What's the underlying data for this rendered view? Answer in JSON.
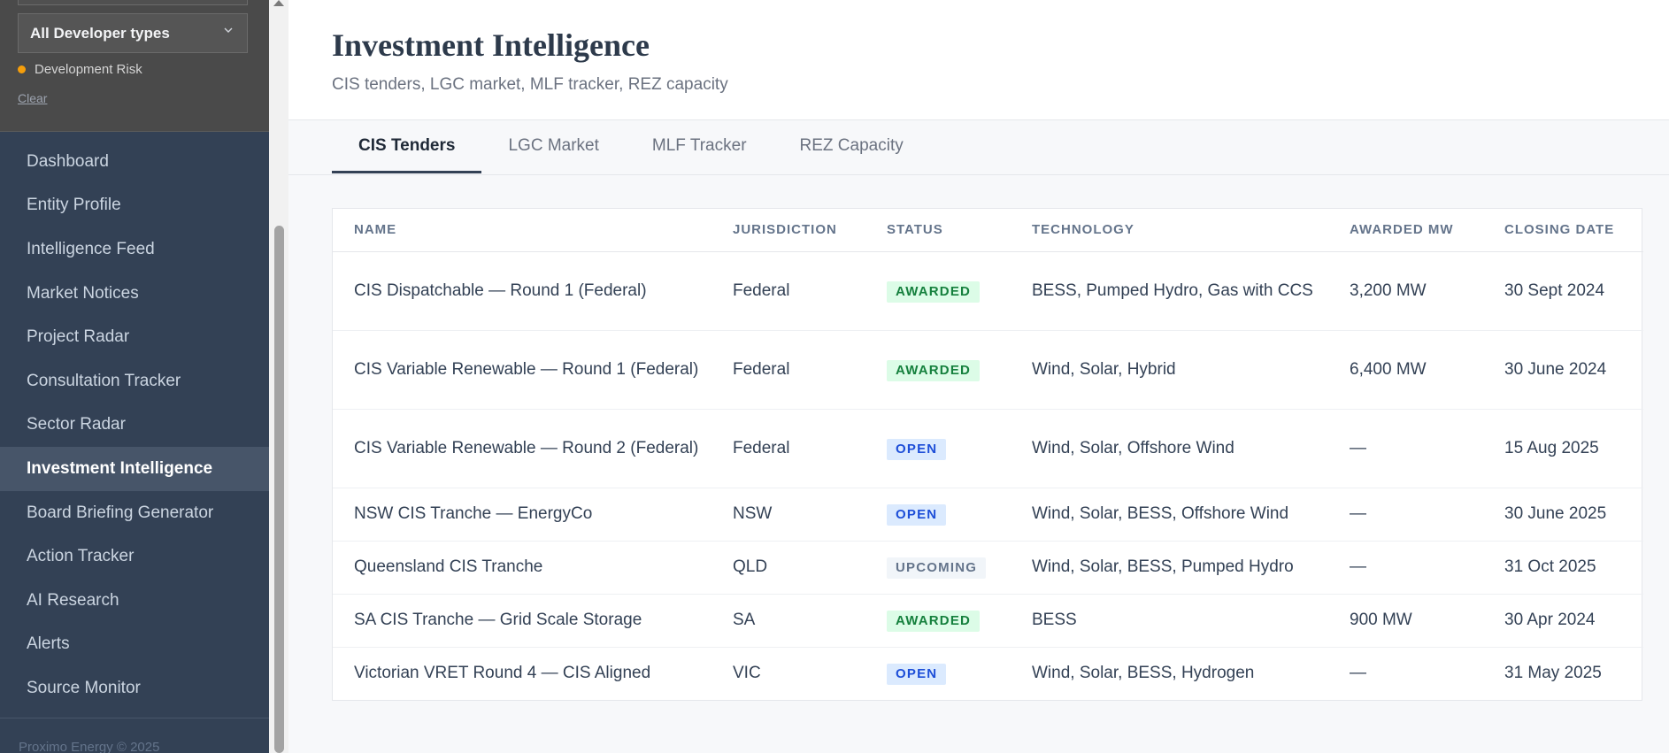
{
  "sidebar": {
    "filter": {
      "developer_select": "All Developer types",
      "chip_label": "Development Risk",
      "chip_color": "#f59e0b",
      "clear_label": "Clear"
    },
    "nav": [
      {
        "label": "Dashboard"
      },
      {
        "label": "Entity Profile"
      },
      {
        "label": "Intelligence Feed"
      },
      {
        "label": "Market Notices"
      },
      {
        "label": "Project Radar"
      },
      {
        "label": "Consultation Tracker"
      },
      {
        "label": "Sector Radar"
      },
      {
        "label": "Investment Intelligence",
        "active": true
      },
      {
        "label": "Board Briefing Generator"
      },
      {
        "label": "Action Tracker"
      },
      {
        "label": "AI Research"
      },
      {
        "label": "Alerts"
      },
      {
        "label": "Source Monitor"
      }
    ],
    "footer": "Proximo Energy © 2025"
  },
  "header": {
    "title": "Investment Intelligence",
    "subtitle": "CIS tenders, LGC market, MLF tracker, REZ capacity"
  },
  "tabs": [
    {
      "label": "CIS Tenders",
      "active": true
    },
    {
      "label": "LGC Market"
    },
    {
      "label": "MLF Tracker"
    },
    {
      "label": "REZ Capacity"
    }
  ],
  "table": {
    "columns": [
      "NAME",
      "JURISDICTION",
      "STATUS",
      "TECHNOLOGY",
      "AWARDED MW",
      "CLOSING DATE"
    ],
    "rows": [
      {
        "name": "CIS Dispatchable — Round 1 (Federal)",
        "jurisdiction": "Federal",
        "status": "AWARDED",
        "technology": "BESS, Pumped Hydro, Gas with CCS",
        "awarded_mw": "3,200 MW",
        "closing_date": "30 Sept 2024"
      },
      {
        "name": "CIS Variable Renewable — Round 1 (Federal)",
        "jurisdiction": "Federal",
        "status": "AWARDED",
        "technology": "Wind, Solar, Hybrid",
        "awarded_mw": "6,400 MW",
        "closing_date": "30 June 2024"
      },
      {
        "name": "CIS Variable Renewable — Round 2 (Federal)",
        "jurisdiction": "Federal",
        "status": "OPEN",
        "technology": "Wind, Solar, Offshore Wind",
        "awarded_mw": "—",
        "closing_date": "15 Aug 2025"
      },
      {
        "name": "NSW CIS Tranche — EnergyCo",
        "jurisdiction": "NSW",
        "status": "OPEN",
        "technology": "Wind, Solar, BESS, Offshore Wind",
        "awarded_mw": "—",
        "closing_date": "30 June 2025"
      },
      {
        "name": "Queensland CIS Tranche",
        "jurisdiction": "QLD",
        "status": "UPCOMING",
        "technology": "Wind, Solar, BESS, Pumped Hydro",
        "awarded_mw": "—",
        "closing_date": "31 Oct 2025"
      },
      {
        "name": "SA CIS Tranche — Grid Scale Storage",
        "jurisdiction": "SA",
        "status": "AWARDED",
        "technology": "BESS",
        "awarded_mw": "900 MW",
        "closing_date": "30 Apr 2024"
      },
      {
        "name": "Victorian VRET Round 4 — CIS Aligned",
        "jurisdiction": "VIC",
        "status": "OPEN",
        "technology": "Wind, Solar, BESS, Hydrogen",
        "awarded_mw": "—",
        "closing_date": "31 May 2025"
      }
    ]
  }
}
